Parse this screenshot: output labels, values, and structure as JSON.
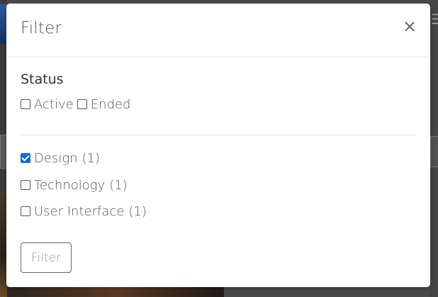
{
  "modal": {
    "title": "Filter",
    "close_glyph": "×"
  },
  "status": {
    "label": "Status",
    "options": [
      {
        "label": "Active",
        "checked": false
      },
      {
        "label": "Ended",
        "checked": false
      }
    ]
  },
  "categories": [
    {
      "label": "Design",
      "count": "(1)",
      "checked": true
    },
    {
      "label": "Technology",
      "count": "(1)",
      "checked": false
    },
    {
      "label": "User Interface",
      "count": "(1)",
      "checked": false
    }
  ],
  "actions": {
    "filter_label": "Filter"
  },
  "colors": {
    "checkbox_accent": "#0b6fe0",
    "backdrop": "#4a4a4a"
  },
  "icons": {
    "close": "close-icon",
    "background_menu": "menu-icon"
  }
}
